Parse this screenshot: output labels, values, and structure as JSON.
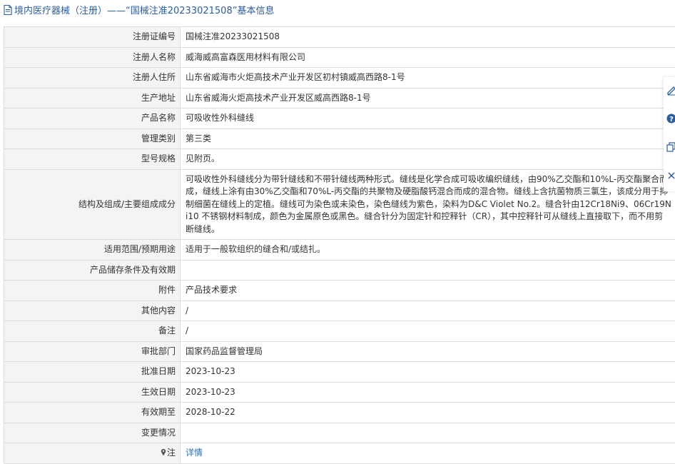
{
  "header": {
    "title": "境内医疗器械（注册）——“国械注准20233021508”基本信息"
  },
  "rows": [
    {
      "label": "注册证编号",
      "value": "国械注准20233021508"
    },
    {
      "label": "注册人名称",
      "value": "威海威高富森医用材料有限公司"
    },
    {
      "label": "注册人住所",
      "value": "山东省威海市火炬高技术产业开发区初村镇威高西路8-1号"
    },
    {
      "label": "生产地址",
      "value": "山东省威海火炬高技术产业开发区威高西路8-1号"
    },
    {
      "label": "产品名称",
      "value": "可吸收性外科缝线"
    },
    {
      "label": "管理类别",
      "value": "第三类"
    },
    {
      "label": "型号规格",
      "value": "见附页。"
    },
    {
      "label": "结构及组成/主要组成成分",
      "value": "可吸收性外科缝线分为带针缝线和不带针缝线两种形式。缝线是化学合成可吸收编织缝线，由90%乙交酯和10%L-丙交酯聚合而成，缝线上涂有由30%乙交酯和70%L-丙交酯的共聚物及硬脂酸钙混合而成的混合物。缝线上含抗菌物质三氯生，该成分用于抑制细菌在缝线上的定植。缝线可为染色或未染色，染色缝线为紫色，染料为D&C Violet No.2。缝合针由12Cr18Ni9、06Cr19Ni10 不锈钢材料制成，颜色为金属原色或黑色。缝合针分为固定针和控释针（CR），其中控释针可从缝线上直接取下，而不用剪断缝线。"
    },
    {
      "label": "适用范围/预期用途",
      "value": "适用于一般软组织的缝合和/或结扎。"
    },
    {
      "label": "产品储存条件及有效期",
      "value": ""
    },
    {
      "label": "附件",
      "value": "产品技术要求"
    },
    {
      "label": "其他内容",
      "value": "/"
    },
    {
      "label": "备注",
      "value": "/"
    },
    {
      "label": "审批部门",
      "value": "国家药品监督管理局"
    },
    {
      "label": "批准日期",
      "value": "2023-10-23"
    },
    {
      "label": "生效日期",
      "value": "2023-10-23"
    },
    {
      "label": "有效期至",
      "value": "2028-10-22"
    },
    {
      "label": "变更情况",
      "value": ""
    },
    {
      "label": "注",
      "value": "详情",
      "is_link": true,
      "icon": "pin-icon"
    }
  ],
  "side_toolbar": {
    "icons": [
      "edit-icon",
      "help-icon",
      "copy-icon",
      "close-icon"
    ]
  },
  "colors": {
    "title_blue": "#2a5d9f",
    "link_blue": "#2a70b8",
    "label_bg": "#f4f4f4",
    "border": "#dcdcdc",
    "text": "#333333"
  }
}
